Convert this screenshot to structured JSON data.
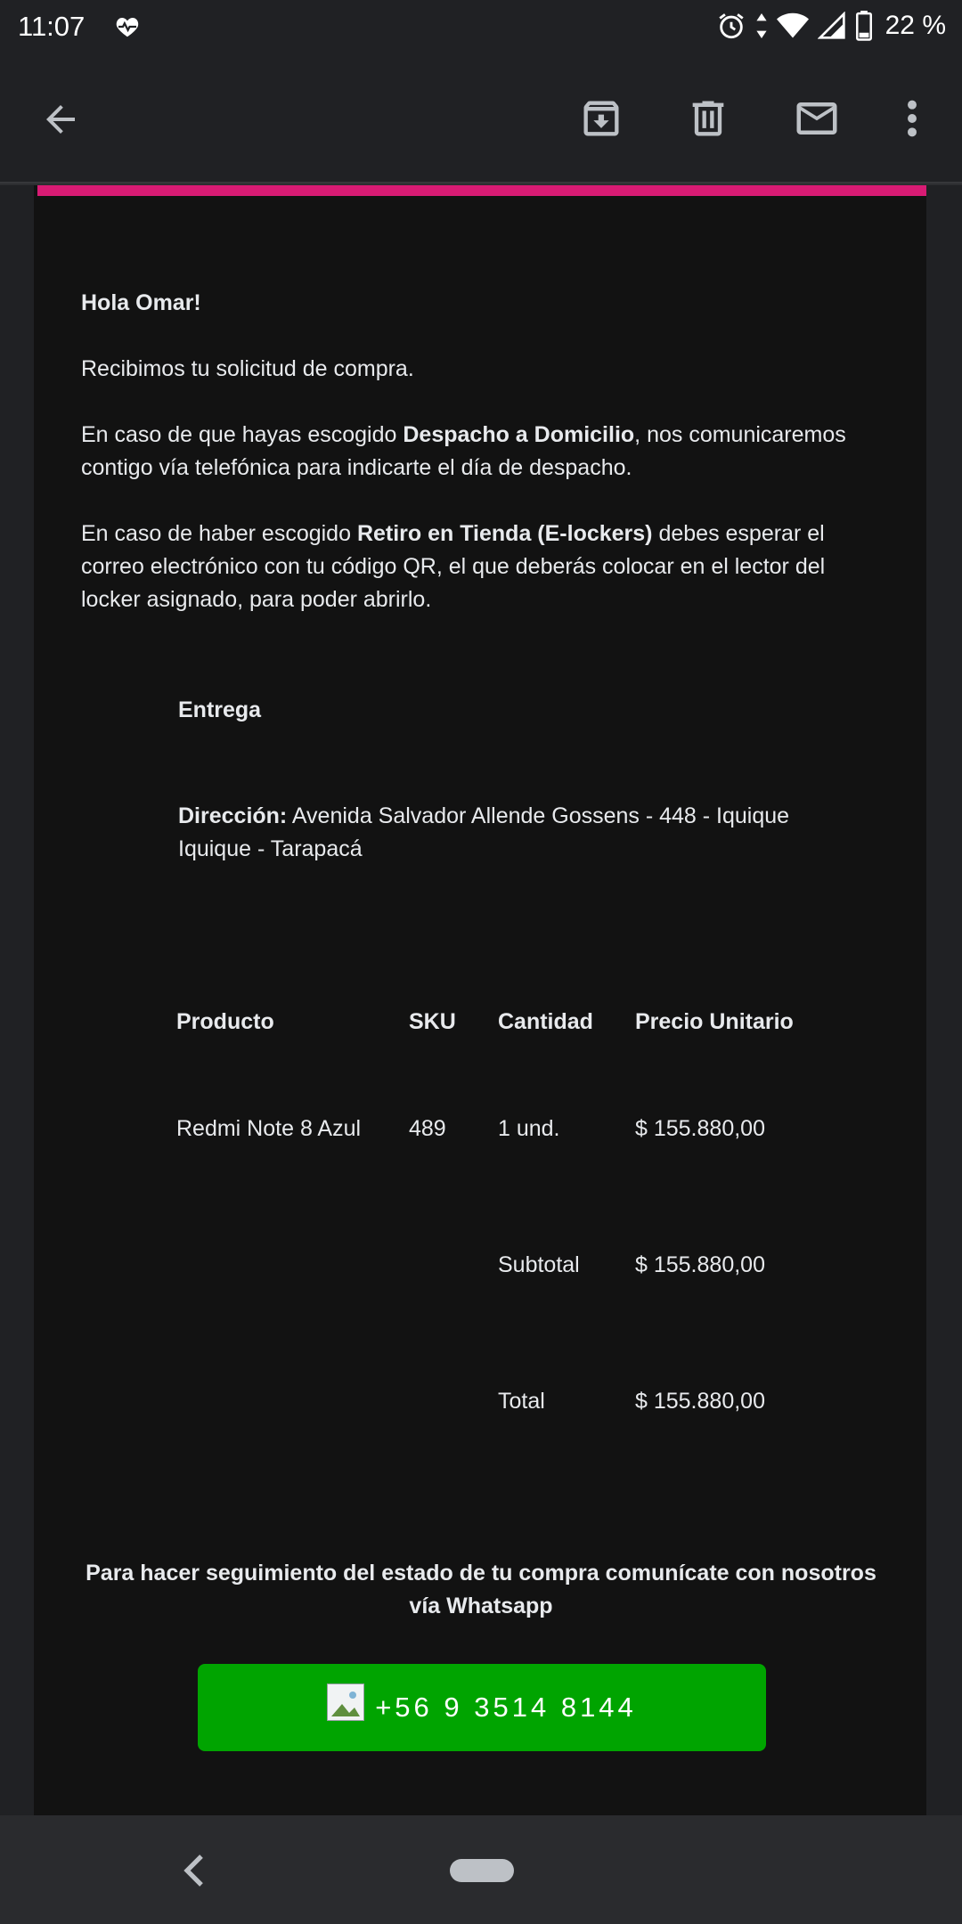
{
  "status_bar": {
    "time": "11:07",
    "battery_text": "22 %",
    "icons": [
      "heart-pulse-icon",
      "alarm-icon",
      "data-arrows-icon",
      "wifi-icon",
      "signal-icon",
      "battery-icon"
    ]
  },
  "app_bar": {
    "icons": [
      "back-arrow-icon",
      "archive-icon",
      "delete-icon",
      "mail-icon",
      "more-vert-icon"
    ]
  },
  "email": {
    "accent_color": "#d81b74",
    "greeting": "Hola Omar!",
    "para1": "Recibimos tu solicitud de compra.",
    "para2_pre": "En caso de que hayas escogido ",
    "para2_bold": "Despacho a Domicilio",
    "para2_post": ", nos comunicaremos contigo vía telefónica para indicarte el día de despacho.",
    "para3_pre": "En caso de haber escogido ",
    "para3_bold": "Retiro en Tienda (E-lockers)",
    "para3_post": " debes esperar el correo electrónico con tu código QR, el que deberás colocar en el lector del locker asignado, para poder abrirlo.",
    "entrega_label": "Entrega",
    "direccion_label": "Dirección:",
    "direccion_value": " Avenida Salvador Allende Gossens - 448 - Iquique Iquique - Tarapacá",
    "table": {
      "headers": [
        "Producto",
        "SKU",
        "Cantidad",
        "Precio Unitario"
      ],
      "rows": [
        [
          "Redmi Note 8 Azul",
          "489",
          "1 und.",
          "$ 155.880,00"
        ]
      ],
      "subtotal_label": "Subtotal",
      "subtotal_value": "$ 155.880,00",
      "total_label": "Total",
      "total_value": "$ 155.880,00"
    },
    "tracking_text": "Para hacer seguimiento del estado de tu compra comunícate con nosotros vía Whatsapp",
    "whatsapp_button": "+56 9 3514 8144",
    "whatsapp_color": "#00a400"
  }
}
